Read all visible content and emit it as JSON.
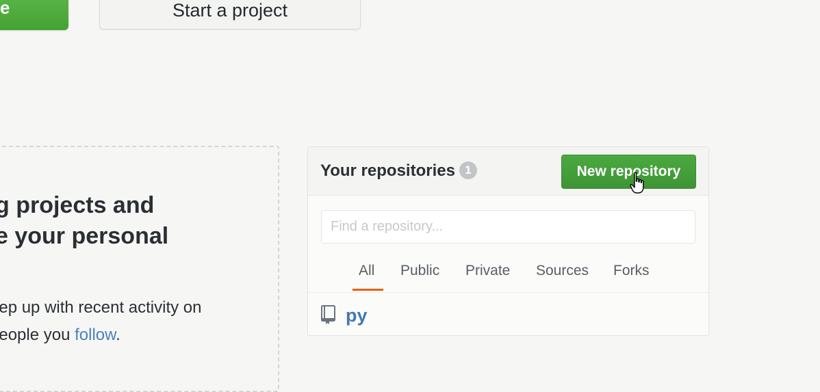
{
  "top_bar": {
    "cta_label": "Read the guide",
    "cta_visible_fragment": "e",
    "start_project_label": "Start a project"
  },
  "intro_panel": {
    "heading_line1": "g projects and",
    "heading_line2": "e your personal",
    "body_line1": "eep up with recent activity on",
    "body_line2_prefix": " people you ",
    "body_link": "follow",
    "body_line2_suffix": "."
  },
  "repositories": {
    "title": "Your repositories",
    "count": "1",
    "new_button_label": "New repository",
    "search": {
      "placeholder": "Find a repository...",
      "value": ""
    },
    "tabs": [
      {
        "label": "All",
        "active": true
      },
      {
        "label": "Public",
        "active": false
      },
      {
        "label": "Private",
        "active": false
      },
      {
        "label": "Sources",
        "active": false
      },
      {
        "label": "Forks",
        "active": false
      }
    ],
    "items": [
      {
        "name": "py",
        "icon": "repo-book-icon"
      }
    ]
  },
  "colors": {
    "accent_green": "#45a132",
    "tab_underline": "#e36209",
    "link_blue": "#4379b4"
  }
}
